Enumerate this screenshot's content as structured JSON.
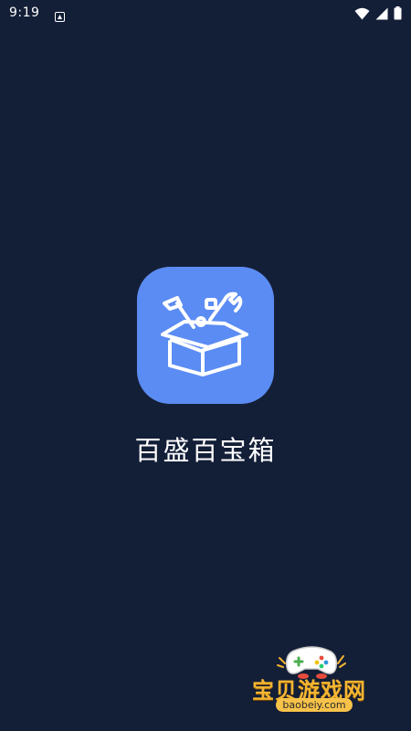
{
  "status_bar": {
    "time": "9:19",
    "notification_icon": "app-notification-icon",
    "wifi_icon": "wifi-icon",
    "signal_icon": "cellular-signal-icon",
    "battery_icon": "battery-icon"
  },
  "splash": {
    "app_name": "百盛百宝箱",
    "app_icon": "toolbox-icon",
    "icon_color": "#5b8cf3",
    "background_color": "#131e37"
  },
  "watermark": {
    "title": "宝贝游戏网",
    "url": "baobeiy.com",
    "title_color": "#f4b531",
    "icon": "gamepad-mascot-icon"
  }
}
